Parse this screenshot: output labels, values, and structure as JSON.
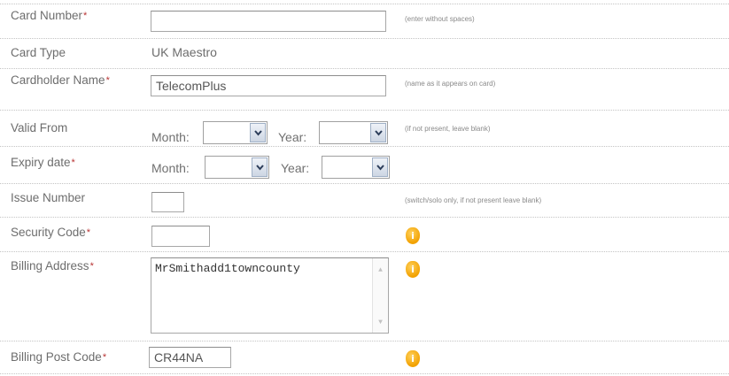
{
  "fields": {
    "card_number": {
      "label": "Card Number",
      "value": "",
      "hint": "(enter without spaces)"
    },
    "card_type": {
      "label": "Card Type",
      "value": "UK Maestro"
    },
    "cardholder_name": {
      "label": "Cardholder Name",
      "value": "TelecomPlus",
      "hint": "(name as it appears on card)"
    },
    "valid_from": {
      "label": "Valid From",
      "month_label": "Month:",
      "year_label": "Year:",
      "month_value": "",
      "year_value": "",
      "hint": "(if not present, leave blank)"
    },
    "expiry_date": {
      "label": "Expiry date",
      "month_label": "Month:",
      "year_label": "Year:",
      "month_value": "",
      "year_value": ""
    },
    "issue_number": {
      "label": "Issue Number",
      "value": "",
      "hint": "(switch/solo only, if not present leave blank)"
    },
    "security_code": {
      "label": "Security Code",
      "value": ""
    },
    "billing_address": {
      "label": "Billing Address",
      "value": "MrSmithadd1towncounty"
    },
    "billing_post_code": {
      "label": "Billing Post Code",
      "value": "CR44NA"
    }
  },
  "required_marker": "*",
  "info_icon_glyph": "i",
  "colors": {
    "label_text": "#6d6d6d",
    "required_star": "#b83434",
    "info_icon": "#f2a100",
    "row_divider": "#c4c4c4"
  },
  "icons": {
    "info": "info-icon",
    "dropdown": "chevron-down-icon",
    "scroll_up": "scroll-up-arrow-icon",
    "scroll_down": "scroll-down-arrow-icon"
  }
}
